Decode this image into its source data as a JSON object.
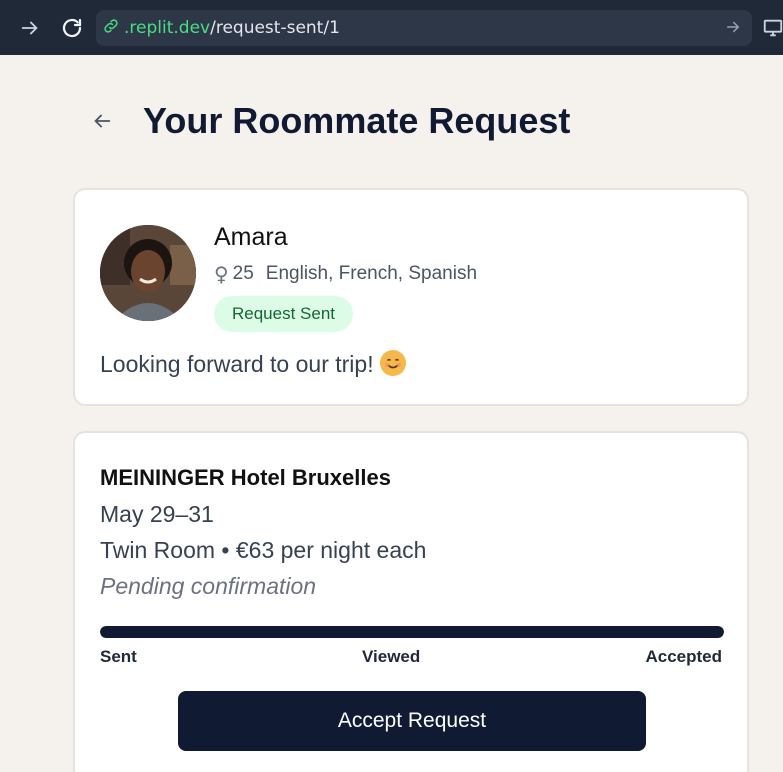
{
  "browser": {
    "url_domain": ".replit.dev",
    "url_path": "/request-sent/1"
  },
  "header": {
    "title": "Your Roommate Request"
  },
  "profile": {
    "name": "Amara",
    "gender_symbol": "♀",
    "age": "25",
    "languages": "English, French, Spanish",
    "badge": "Request Sent",
    "message": "Looking forward to our trip!"
  },
  "hotel": {
    "name": "MEININGER Hotel Bruxelles",
    "dates": "May 29–31",
    "room": "Twin Room • €63 per night each",
    "status": "Pending confirmation",
    "progress_fraction": 1.0,
    "steps": [
      "Sent",
      "Viewed",
      "Accepted"
    ],
    "accept_label": "Accept Request"
  },
  "colors": {
    "primary": "#111a33",
    "badge_bg": "#dcfce7",
    "badge_text": "#166534",
    "page_bg": "#f5f1ec"
  },
  "icons": [
    "arrow-right-icon",
    "reload-icon",
    "link-icon",
    "back-arrow-icon",
    "monitor-icon",
    "smile-emoji-icon"
  ]
}
